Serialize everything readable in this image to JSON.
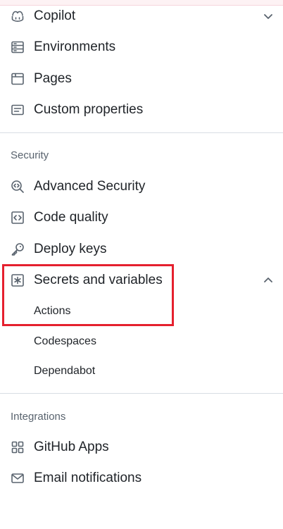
{
  "nav": {
    "top_items": [
      {
        "label": "Copilot",
        "icon": "copilot-icon",
        "chevron": "chevron-down"
      },
      {
        "label": "Environments",
        "icon": "server-icon"
      },
      {
        "label": "Pages",
        "icon": "browser-icon"
      },
      {
        "label": "Custom properties",
        "icon": "note-icon"
      }
    ],
    "security": {
      "title": "Security",
      "items": [
        {
          "label": "Advanced Security",
          "icon": "codescan-icon"
        },
        {
          "label": "Code quality",
          "icon": "code-square-icon"
        },
        {
          "label": "Deploy keys",
          "icon": "key-icon"
        },
        {
          "label": "Secrets and variables",
          "icon": "asterisk-icon",
          "chevron": "chevron-up",
          "subitems": [
            "Actions",
            "Codespaces",
            "Dependabot"
          ]
        }
      ]
    },
    "integrations": {
      "title": "Integrations",
      "items": [
        {
          "label": "GitHub Apps",
          "icon": "apps-icon"
        },
        {
          "label": "Email notifications",
          "icon": "mail-icon"
        }
      ]
    }
  },
  "highlight_color": "#e5202e"
}
